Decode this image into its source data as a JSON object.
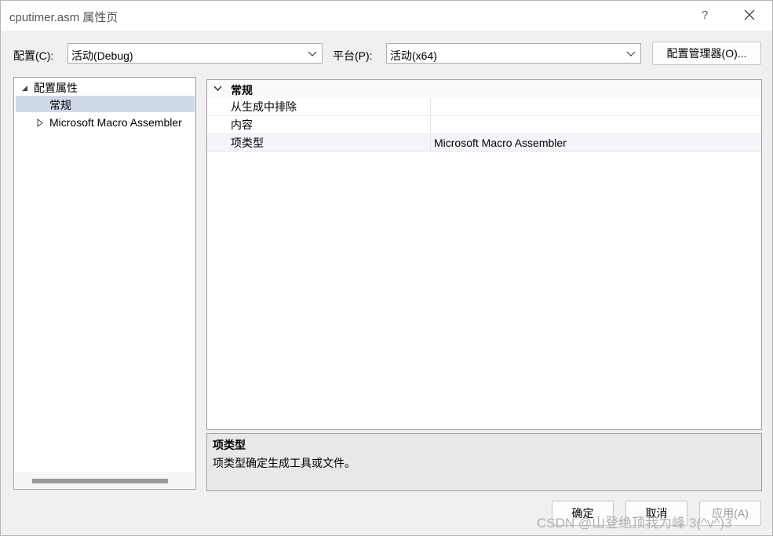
{
  "window": {
    "title": "cputimer.asm 属性页",
    "help_label": "?"
  },
  "config_bar": {
    "config_label": "配置(C):",
    "config_value": "活动(Debug)",
    "platform_label": "平台(P):",
    "platform_value": "活动(x64)",
    "manager_button": "配置管理器(O)..."
  },
  "tree": {
    "root_label": "配置属性",
    "items": [
      {
        "label": "常规"
      },
      {
        "label": "Microsoft Macro Assembler"
      }
    ]
  },
  "grid": {
    "section": "常规",
    "rows": [
      {
        "label": "从生成中排除",
        "value": ""
      },
      {
        "label": "内容",
        "value": ""
      },
      {
        "label": "项类型",
        "value": "Microsoft Macro Assembler"
      }
    ]
  },
  "description": {
    "title": "项类型",
    "text": "项类型确定生成工具或文件。"
  },
  "buttons": {
    "ok": "确定",
    "cancel": "取消",
    "apply": "应用(A)"
  },
  "watermark": "CSDN @山登绝顶我为峰 3(^v^)3"
}
